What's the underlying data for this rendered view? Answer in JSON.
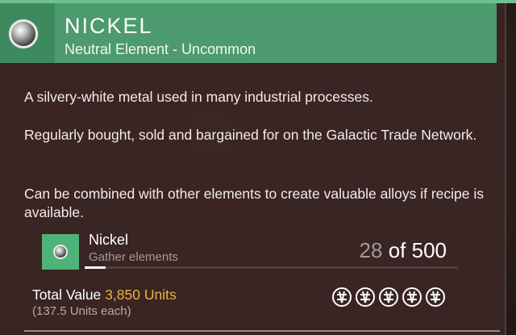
{
  "item": {
    "title": "NICKEL",
    "subtitle": "Neutral Element - Uncommon",
    "icon": "nickel-orb-icon"
  },
  "description": [
    "A silvery-white metal used in many industrial processes.",
    "Regularly bought, sold and bargained for on the Galactic Trade Network.",
    "Can be combined with other elements to create valuable alloys if recipe is available."
  ],
  "inventory": {
    "name": "Nickel",
    "hint": "Gather elements",
    "current": "28",
    "of_label": "of",
    "max": "500",
    "progress_fraction": 0.056
  },
  "value": {
    "label": "Total Value",
    "amount": "3,850 Units",
    "per_unit": "(137.5 Units each)",
    "rarity_coins": 5
  },
  "colors": {
    "header": "#4d9a6e",
    "accent_stripe": "#6fc190",
    "value_text": "#e9b44a",
    "panel": "#3a2624"
  }
}
